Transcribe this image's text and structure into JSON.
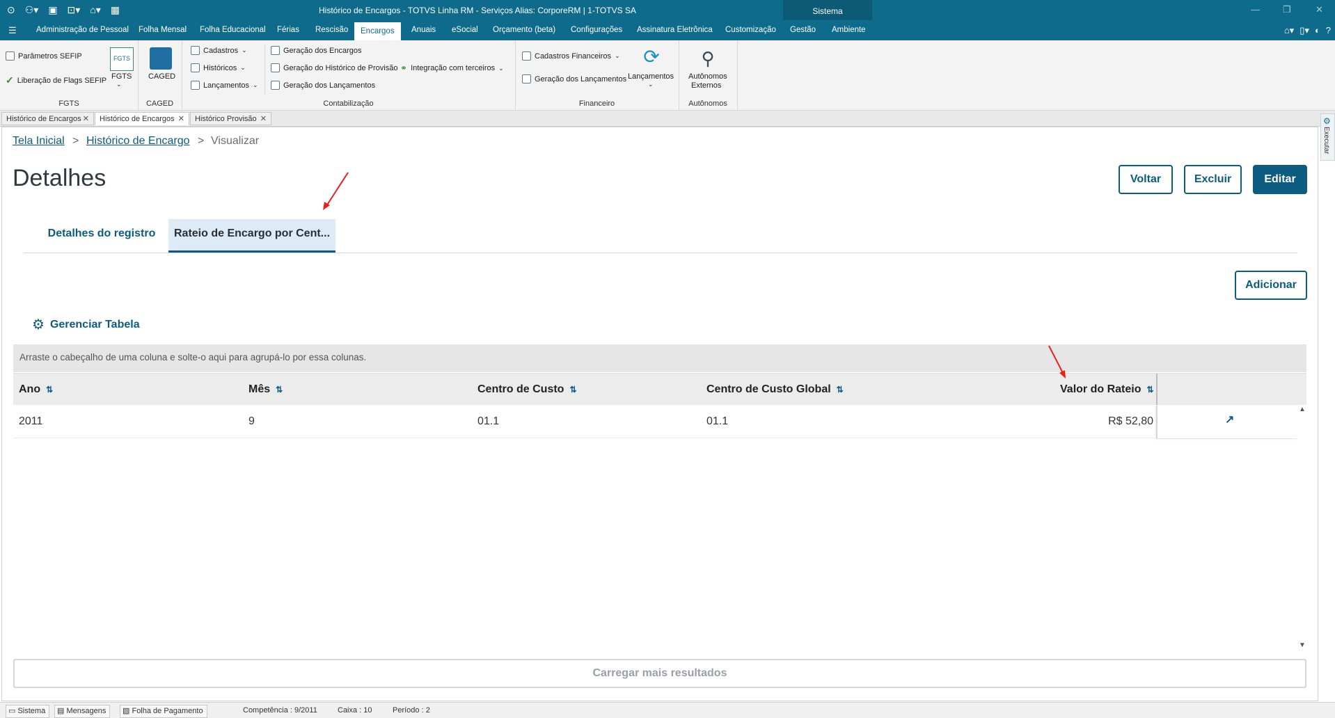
{
  "window": {
    "title": "Histórico de Encargos - TOTVS Linha RM - Serviços  Alias: CorporeRM | 1-TOTVS SA",
    "sistema_label": "Sistema"
  },
  "menu": {
    "items": [
      "Administração de Pessoal",
      "Folha Mensal",
      "Folha Educacional",
      "Férias",
      "Rescisão",
      "Encargos",
      "Anuais",
      "eSocial",
      "Orçamento (beta)",
      "Configurações",
      "Assinatura Eletrônica",
      "Customização",
      "Gestão",
      "Ambiente"
    ],
    "active": "Encargos"
  },
  "ribbon": {
    "fgts": {
      "parametros": "Parâmetros SEFIP",
      "liberacao": "Liberação de Flags SEFIP",
      "fgts_button": "FGTS",
      "fgts_badge": "FGTS",
      "group_label": "FGTS"
    },
    "caged": {
      "button": "CAGED",
      "group_label": "CAGED"
    },
    "contabilizacao": {
      "cadastros": "Cadastros",
      "historicos": "Históricos",
      "lancamentos": "Lançamentos",
      "geracao_encargos": "Geração dos Encargos",
      "geracao_historico": "Geração do Histórico de Provisão",
      "geracao_lancamentos": "Geração dos Lançamentos",
      "integracao": "Integração com terceiros",
      "group_label": "Contabilização"
    },
    "financeiro": {
      "cadastros_financeiros": "Cadastros Financeiros",
      "geracao_lancamentos": "Geração dos Lançamentos",
      "lancamentos": "Lançamentos",
      "group_label": "Financeiro"
    },
    "autonomos": {
      "button_line1": "Autônomos",
      "button_line2": "Externos",
      "group_label": "Autônomos"
    }
  },
  "doc_tabs": [
    "Histórico de Encargos",
    "Histórico de Encargos",
    "Histórico Provisão"
  ],
  "side_strip": {
    "label": "Executar"
  },
  "breadcrumb": {
    "home": "Tela Inicial",
    "parent": "Histórico de Encargo",
    "current": "Visualizar",
    "separator": ">"
  },
  "page": {
    "title": "Detalhes",
    "buttons": {
      "back": "Voltar",
      "delete": "Excluir",
      "edit": "Editar"
    }
  },
  "tabs": {
    "details": "Detalhes do registro",
    "rateio": "Rateio de Encargo por Cent..."
  },
  "grid": {
    "add_button": "Adicionar",
    "manage_table": "Gerenciar Tabela",
    "group_hint": "Arraste o cabeçalho de uma coluna e solte-o aqui para agrupá-lo por essa colunas.",
    "columns": [
      "Ano",
      "Mês",
      "Centro de Custo",
      "Centro de Custo Global",
      "Valor do Rateio"
    ],
    "rows": [
      {
        "ano": "2011",
        "mes": "9",
        "centro_custo": "01.1",
        "centro_custo_global": "01.1",
        "valor_rateio": "R$ 52,80"
      }
    ],
    "load_more": "Carregar mais resultados"
  },
  "statusbar": {
    "sistema": "Sistema",
    "mensagens": "Mensagens",
    "folha": "Folha de Pagamento",
    "competencia": "Competência : 9/2011",
    "caixa": "Caixa : 10",
    "periodo": "Período : 2"
  },
  "colors": {
    "header_bg": "#0f6b8c",
    "accent": "#0c5b80",
    "annotation": "#e8201a"
  }
}
